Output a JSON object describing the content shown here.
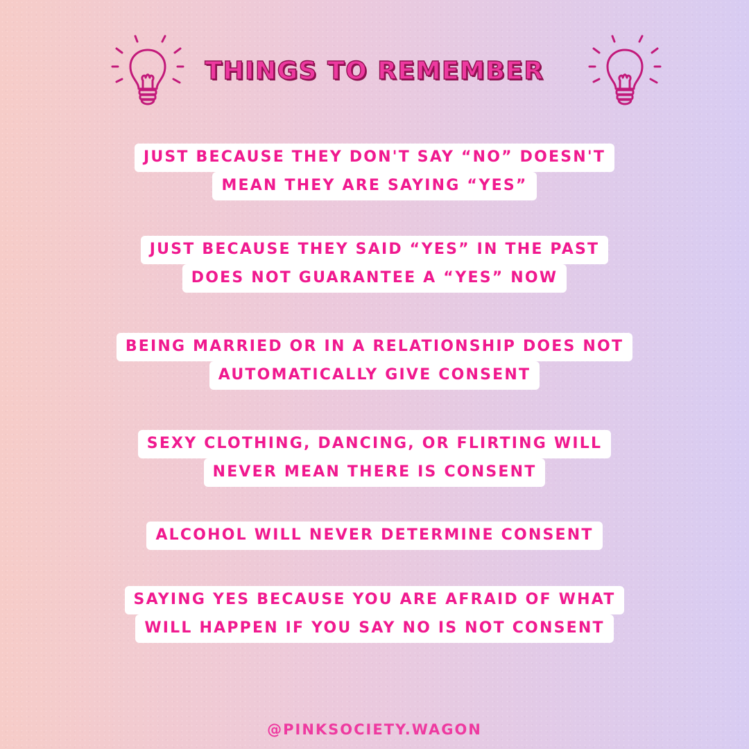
{
  "title": "THINGS TO REMEMBER",
  "colors": {
    "accent": "#f0198f",
    "title_fill": "#ee3aa0",
    "title_outline": "#8e1150",
    "background_left": "#f6ccc8",
    "background_right": "#d8ccf2",
    "box": "#ffffff"
  },
  "icons": [
    "lightbulb-icon",
    "lightbulb-icon"
  ],
  "items": [
    {
      "lines": [
        "JUST BECAUSE THEY DON'T SAY “NO” DOESN'T",
        "MEAN THEY ARE SAYING “YES”"
      ]
    },
    {
      "lines": [
        "JUST BECAUSE THEY SAID “YES” IN THE PAST",
        "DOES NOT GUARANTEE A “YES” NOW"
      ]
    },
    {
      "lines": [
        "BEING MARRIED OR IN A RELATIONSHIP DOES NOT",
        "AUTOMATICALLY GIVE CONSENT"
      ]
    },
    {
      "lines": [
        "SEXY CLOTHING, DANCING, OR FLIRTING WILL",
        "NEVER MEAN THERE IS CONSENT"
      ]
    },
    {
      "lines": [
        "ALCOHOL WILL NEVER DETERMINE CONSENT"
      ]
    },
    {
      "lines": [
        "SAYING YES BECAUSE YOU ARE AFRAID OF WHAT",
        "WILL HAPPEN IF YOU SAY NO IS NOT CONSENT"
      ]
    }
  ],
  "footer": {
    "handle": "@PINKSOCIETY.WAGON"
  }
}
